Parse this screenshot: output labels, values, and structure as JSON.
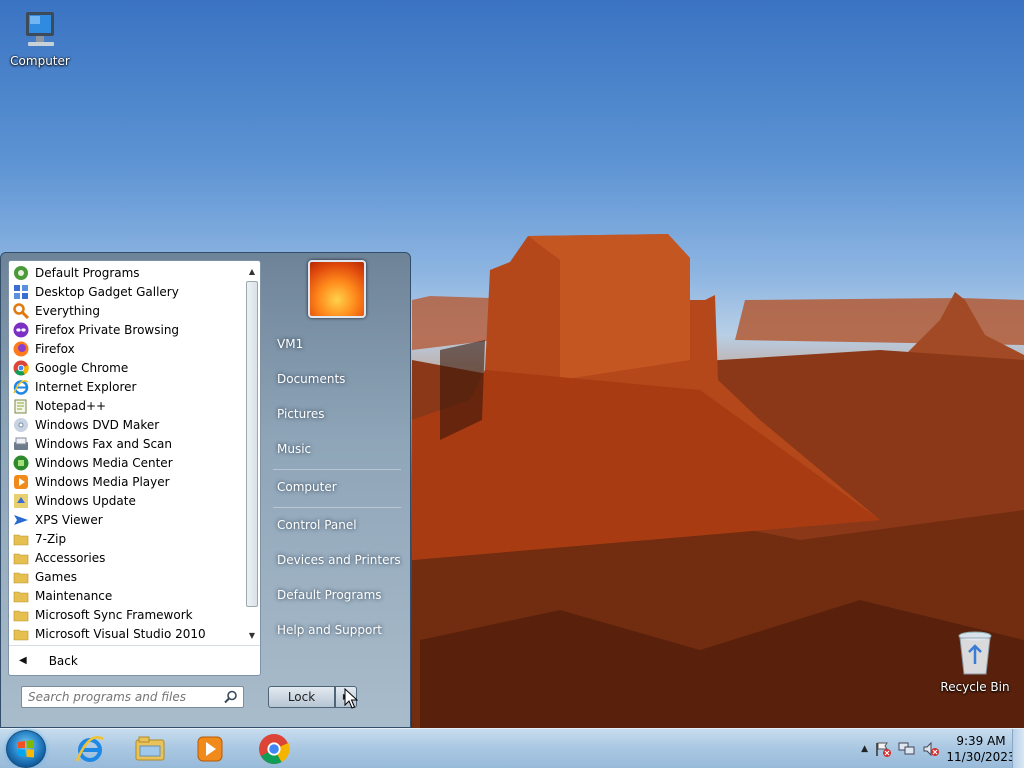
{
  "desktop": {
    "icons": [
      {
        "label": "Computer",
        "icon": "computer-icon"
      },
      {
        "label": "Recycle Bin",
        "icon": "recycle-bin-icon"
      }
    ]
  },
  "start_menu": {
    "programs": [
      {
        "label": "Default Programs",
        "icon": "default-programs-icon"
      },
      {
        "label": "Desktop Gadget Gallery",
        "icon": "gadget-gallery-icon"
      },
      {
        "label": "Everything",
        "icon": "everything-search-icon"
      },
      {
        "label": "Firefox Private Browsing",
        "icon": "firefox-private-icon"
      },
      {
        "label": "Firefox",
        "icon": "firefox-icon"
      },
      {
        "label": "Google Chrome",
        "icon": "chrome-icon"
      },
      {
        "label": "Internet Explorer",
        "icon": "internet-explorer-icon"
      },
      {
        "label": "Notepad++",
        "icon": "notepad-plus-plus-icon"
      },
      {
        "label": "Windows DVD Maker",
        "icon": "dvd-maker-icon"
      },
      {
        "label": "Windows Fax and Scan",
        "icon": "fax-scan-icon"
      },
      {
        "label": "Windows Media Center",
        "icon": "media-center-icon"
      },
      {
        "label": "Windows Media Player",
        "icon": "media-player-icon"
      },
      {
        "label": "Windows Update",
        "icon": "windows-update-icon"
      },
      {
        "label": "XPS Viewer",
        "icon": "xps-viewer-icon"
      },
      {
        "label": "7-Zip",
        "icon": "folder-icon"
      },
      {
        "label": "Accessories",
        "icon": "folder-icon"
      },
      {
        "label": "Games",
        "icon": "folder-icon"
      },
      {
        "label": "Maintenance",
        "icon": "folder-icon"
      },
      {
        "label": "Microsoft Sync Framework",
        "icon": "folder-icon"
      },
      {
        "label": "Microsoft Visual Studio 2010",
        "icon": "folder-icon"
      }
    ],
    "back_label": "Back",
    "search_placeholder": "Search programs and files",
    "right_items": {
      "user": "VM1",
      "documents": "Documents",
      "pictures": "Pictures",
      "music": "Music",
      "computer": "Computer",
      "control_panel": "Control Panel",
      "devices_printers": "Devices and Printers",
      "default_programs": "Default Programs",
      "help_support": "Help and Support"
    },
    "lock_label": "Lock"
  },
  "taskbar": {
    "pinned": [
      "internet-explorer-icon",
      "windows-explorer-icon",
      "media-player-icon",
      "chrome-icon"
    ],
    "clock": {
      "time": "9:39 AM",
      "date": "11/30/2023"
    }
  },
  "colors": {
    "taskbar": "#a9c7e2",
    "start_menu": "#8fa5b8",
    "sky": "#5c93d3",
    "rock": "#9a4a24"
  }
}
